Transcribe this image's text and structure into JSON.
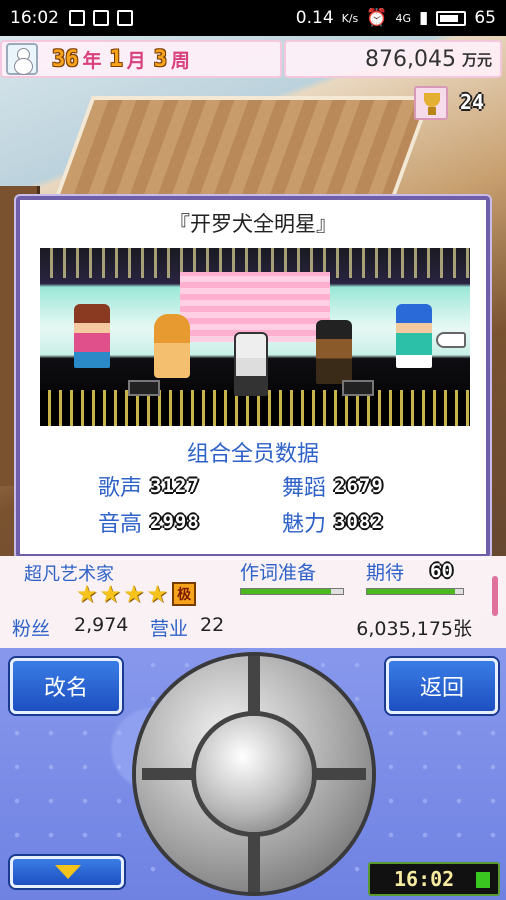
{
  "status_bar": {
    "time": "16:02",
    "network_speed": "0.14",
    "network_speed_unit": "K/s",
    "network_type": "4G",
    "battery": "65"
  },
  "hud": {
    "year": "36",
    "year_unit": "年",
    "month": "1",
    "month_unit": "月",
    "week": "3",
    "week_unit": "周",
    "money": "876,045",
    "money_unit": "万元",
    "trophy_count": "24"
  },
  "dialog": {
    "title": "『开罗犬全明星』",
    "stats_title": "组合全员数据",
    "stats": [
      {
        "label": "歌声",
        "value": "3127"
      },
      {
        "label": "舞蹈",
        "value": "2679"
      },
      {
        "label": "音高",
        "value": "2998"
      },
      {
        "label": "魅力",
        "value": "3082"
      }
    ]
  },
  "info_panel": {
    "rank_label": "超凡艺术家",
    "stars": 4,
    "grade": "极",
    "task_label": "作词准备",
    "task_progress": 0.88,
    "expect_label": "期待",
    "expect_value": "60",
    "expect_progress": 0.92,
    "fans_label": "粉丝",
    "fans_value": "2,974",
    "business_label": "营业",
    "business_value": "22",
    "sales": "6,035,175张"
  },
  "controls": {
    "rename_label": "改名",
    "back_label": "返回",
    "clock": "16:02"
  },
  "colors": {
    "accent_blue": "#2f62c8",
    "dialog_border": "#6e5fa8",
    "pad_bg": "#7b8ee6",
    "progress_green": "#4cb820"
  }
}
